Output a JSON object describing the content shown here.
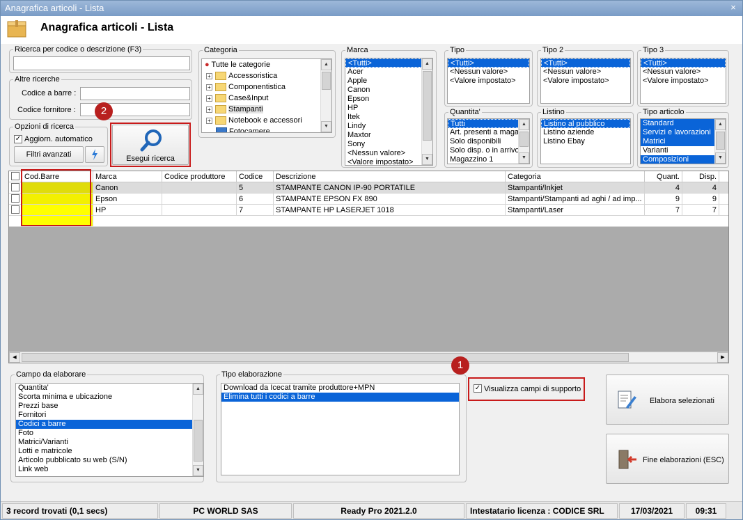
{
  "window": {
    "title": "Anagrafica articoli  - Lista",
    "close": "×"
  },
  "header": {
    "title": "Anagrafica articoli  - Lista",
    "icon": "box-icon"
  },
  "search": {
    "legend": "Ricerca per codice o descrizione (F3)",
    "value": ""
  },
  "altre": {
    "legend": "Altre ricerche",
    "barcode_label": "Codice a barre :",
    "supplier_label": "Codice fornitore :"
  },
  "options": {
    "legend": "Opzioni di ricerca",
    "auto_update": "Aggiorn. automatico",
    "advanced": "Filtri avanzati"
  },
  "search_button": {
    "label": "Esegui ricerca"
  },
  "categoria": {
    "legend": "Categoria",
    "root": "Tutte le categorie",
    "items": [
      "Accessoristica",
      "Componentistica",
      "Case&Input",
      "Stampanti",
      "Notebook e accessori",
      "Fotocamere"
    ]
  },
  "marca": {
    "legend": "Marca",
    "items": [
      "<Tutti>",
      "Acer",
      "Apple",
      "Canon",
      "Epson",
      "HP",
      "Itek",
      "Lindy",
      "Maxtor",
      "Sony",
      "<Nessun valore>",
      "<Valore impostato>"
    ]
  },
  "tipo": {
    "legend": "Tipo",
    "items": [
      "<Tutti>",
      "<Nessun valore>",
      "<Valore impostato>"
    ]
  },
  "tipo2": {
    "legend": "Tipo 2",
    "items": [
      "<Tutti>",
      "<Nessun valore>",
      "<Valore impostato>"
    ]
  },
  "tipo3": {
    "legend": "Tipo 3",
    "items": [
      "<Tutti>",
      "<Nessun valore>",
      "<Valore impostato>"
    ]
  },
  "quantita": {
    "legend": "Quantita'",
    "items": [
      "Tutti",
      "Art. presenti a magazzino",
      "Solo disponibili",
      "Solo disp. o in arrivo",
      "Magazzino 1"
    ]
  },
  "listino": {
    "legend": "Listino",
    "items": [
      "Listino al pubblico",
      "Listino aziende",
      "Listino Ebay"
    ]
  },
  "tipo_articolo": {
    "legend": "Tipo articolo",
    "items": [
      "Standard",
      "Servizi e lavorazioni",
      "Matrici",
      "Varianti",
      "Composizioni"
    ]
  },
  "grid": {
    "headers": [
      "Cod.Barre",
      "Marca",
      "Codice produttore",
      "Codice",
      "Descrizione",
      "Categoria",
      "Quant.",
      "Disp."
    ],
    "rows": [
      {
        "barcode": "",
        "marca": "Canon",
        "prod": "",
        "codice": "5",
        "descr": "STAMPANTE CANON IP-90 PORTATILE",
        "cat": "Stampanti/Inkjet",
        "qty": "4",
        "disp": "4"
      },
      {
        "barcode": "",
        "marca": "Epson",
        "prod": "",
        "codice": "6",
        "descr": "STAMPANTE EPSON FX 890",
        "cat": "Stampanti/Stampanti ad aghi / ad imp...",
        "qty": "9",
        "disp": "9"
      },
      {
        "barcode": "",
        "marca": "HP",
        "prod": "",
        "codice": "7",
        "descr": "STAMPANTE HP LASERJET 1018",
        "cat": "Stampanti/Laser",
        "qty": "7",
        "disp": "7"
      }
    ]
  },
  "campo": {
    "legend": "Campo da elaborare",
    "items": [
      "Quantita'",
      "Scorta minima e ubicazione",
      "Prezzi base",
      "Fornitori",
      "Codici a barre",
      "Foto",
      "Matrici/Varianti",
      "Lotti e matricole",
      "Articolo pubblicato su web (S/N)",
      "Link web"
    ]
  },
  "tipo_elab": {
    "legend": "Tipo elaborazione",
    "items": [
      "Download da Icecat tramite produttore+MPN",
      "Elimina tutti i codici a barre"
    ]
  },
  "support": {
    "label": "Visualizza campi di supporto"
  },
  "actions": {
    "process": "Elabora selezionati",
    "finish": "Fine elaborazioni (ESC)"
  },
  "badges": {
    "one": "1",
    "two": "2"
  },
  "status": {
    "records": "3 record trovati (0,1 secs)",
    "company": "PC WORLD SAS",
    "version": "Ready Pro 2021.2.0",
    "license": "Intestatario licenza : CODICE SRL",
    "date": "17/03/2021",
    "time": "09:31"
  }
}
